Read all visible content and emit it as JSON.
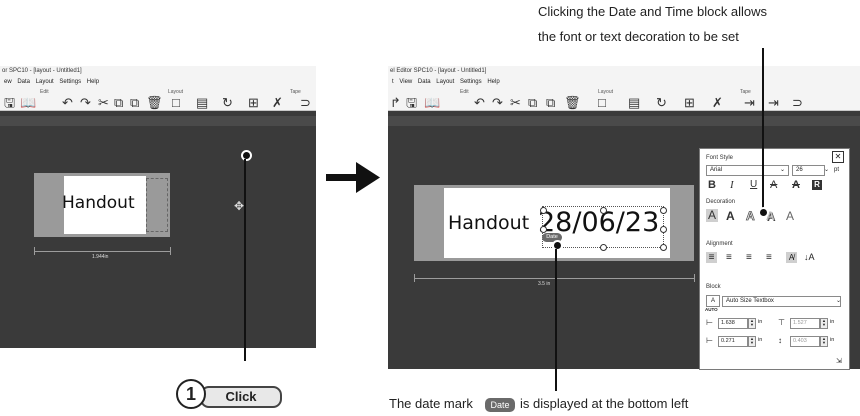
{
  "left_shot": {
    "title": "or SPC10 - [layout - Untitled1]",
    "menu": [
      "ew",
      "Data",
      "Layout",
      "Settings",
      "Help"
    ],
    "group_edit": "Edit",
    "group_layout": "Layout",
    "group_tape": "Tape",
    "label_text": "Handout",
    "dimension": "1.944in"
  },
  "right_shot": {
    "title": "el Editor SPC10 - [layout - Untitled1]",
    "menu": [
      "t",
      "View",
      "Data",
      "Layout",
      "Settings",
      "Help"
    ],
    "group_edit": "Edit",
    "group_layout": "Layout",
    "group_tape": "Tape",
    "label_text": "Handout",
    "date_text": "28/06/23",
    "date_mark": "Date",
    "dimension": "3.5 in"
  },
  "panel": {
    "font_style_title": "Font Style",
    "font_name": "Arial",
    "font_size": "26",
    "font_unit": "pt",
    "style_buttons": [
      "B",
      "I",
      "U",
      "A",
      "A",
      "R"
    ],
    "decoration_title": "Decoration",
    "decoration_buttons": [
      "A",
      "A",
      "A",
      "A",
      "A"
    ],
    "alignment_title": "Alignment",
    "block_title": "Block",
    "block_mode": "Auto Size Textbox",
    "auto_label": "AUTO",
    "x_value": "1.638",
    "width_value": "1.527",
    "y_value": "0.271",
    "height_value": "0.403",
    "unit": "in"
  },
  "annotations": {
    "top_note_line1": "Clicking the Date and Time block allows",
    "top_note_line2": "the font or text decoration to be set",
    "step_number": "1",
    "step_action": "Click",
    "bottom_note_pre": "The date mark",
    "bottom_note_mark": "Date",
    "bottom_note_post": "is displayed at the bottom left"
  },
  "colors": {
    "canvas": "#3a3a3a",
    "toolbar": "#f4f4f4",
    "label_border": "#9a9a9a",
    "arrow": "#111111"
  }
}
